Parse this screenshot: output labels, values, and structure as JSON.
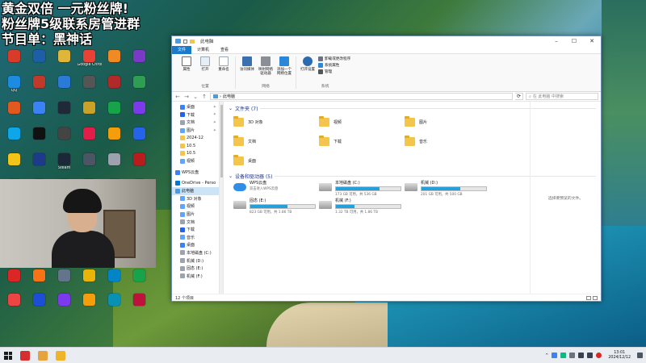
{
  "overlay": {
    "line1": "黄金双倍 一元粉丝牌!",
    "line2": "粉丝牌5级联系房管进群",
    "line3": "节目单：黑神话"
  },
  "desktop_icons": [
    {
      "label": "",
      "color": "#d83b2a"
    },
    {
      "label": "",
      "color": "#1c5fa8"
    },
    {
      "label": "",
      "color": "#e0b63a"
    },
    {
      "label": "Google Chrome",
      "color": "#e94235"
    },
    {
      "label": "",
      "color": "#f08a24"
    },
    {
      "label": "",
      "color": "#7b3ac6"
    },
    {
      "label": "QQ",
      "color": "#1d8ce0"
    },
    {
      "label": "",
      "color": "#c0392b"
    },
    {
      "label": "",
      "color": "#2b7bd6"
    },
    {
      "label": "",
      "color": "#555"
    },
    {
      "label": "",
      "color": "#b12a2a"
    },
    {
      "label": "",
      "color": "#2e9e53"
    },
    {
      "label": "",
      "color": "#e05a20"
    },
    {
      "label": "",
      "color": "#3b82f6"
    },
    {
      "label": "",
      "color": "#1f2937"
    },
    {
      "label": "",
      "color": "#c9a227"
    },
    {
      "label": "",
      "color": "#16a34a"
    },
    {
      "label": "",
      "color": "#7c3aed"
    },
    {
      "label": "",
      "color": "#0ea5e9"
    },
    {
      "label": "",
      "color": "#111"
    },
    {
      "label": "",
      "color": "#444"
    },
    {
      "label": "",
      "color": "#e11d48"
    },
    {
      "label": "",
      "color": "#f59e0b"
    },
    {
      "label": "",
      "color": "#2563eb"
    },
    {
      "label": "",
      "color": "#f0c419"
    },
    {
      "label": "",
      "color": "#1e3a8a"
    },
    {
      "label": "Steam",
      "color": "#1b2838"
    },
    {
      "label": "",
      "color": "#4b5563"
    },
    {
      "label": "",
      "color": "#9ca3af"
    },
    {
      "label": "",
      "color": "#b91c1c"
    },
    {
      "label": "",
      "color": "#e5484d"
    },
    {
      "label": "",
      "color": "#0f766e"
    },
    {
      "label": "",
      "color": "#dc2626"
    },
    {
      "label": "",
      "color": "#555"
    },
    {
      "label": "",
      "color": "#ea580c"
    },
    {
      "label": "",
      "color": "#334155"
    }
  ],
  "desktop_icons_bottom": [
    {
      "label": "",
      "color": "#dc2626"
    },
    {
      "label": "",
      "color": "#f97316"
    },
    {
      "label": "",
      "color": "#64748b"
    },
    {
      "label": "",
      "color": "#eab308"
    },
    {
      "label": "",
      "color": "#0284c7"
    },
    {
      "label": "",
      "color": "#16a34a"
    },
    {
      "label": "",
      "color": "#ef4444"
    },
    {
      "label": "",
      "color": "#1d4ed8"
    },
    {
      "label": "",
      "color": "#7c3aed"
    },
    {
      "label": "",
      "color": "#f59e0b"
    },
    {
      "label": "",
      "color": "#0891b2"
    },
    {
      "label": "",
      "color": "#be123c"
    }
  ],
  "window": {
    "title": "此电脑",
    "tabs": [
      "文件",
      "计算机",
      "查看"
    ],
    "ribbon": {
      "location_group": "位置",
      "network_group": "网络",
      "system_group": "系统",
      "properties": "属性",
      "open": "打开",
      "rename": "重命名",
      "access_media": "访问媒体",
      "map_drive": "映射网络驱动器",
      "add_location": "添加一个网络位置",
      "open_settings": "打开设置",
      "uninstall": "卸载或更改程序",
      "sys_props": "系统属性",
      "manage": "管理"
    },
    "address": "此电脑",
    "search_placeholder": "在 此电脑 中搜索"
  },
  "nav": [
    {
      "label": "桌面",
      "sub": true,
      "pin": true,
      "color": "#3b82f6"
    },
    {
      "label": "下载",
      "sub": true,
      "pin": true,
      "color": "#2563eb"
    },
    {
      "label": "文档",
      "sub": true,
      "pin": true,
      "color": "#9ca3af"
    },
    {
      "label": "图片",
      "sub": true,
      "pin": true,
      "color": "#60a5fa"
    },
    {
      "label": "2024-12",
      "sub": true,
      "pin": false,
      "color": "#f3c54d"
    },
    {
      "label": "10.5",
      "sub": true,
      "pin": false,
      "color": "#f3c54d"
    },
    {
      "label": "10.5",
      "sub": true,
      "pin": false,
      "color": "#f3c54d"
    },
    {
      "label": "视频",
      "sub": true,
      "pin": false,
      "color": "#60a5fa"
    },
    {
      "label": "",
      "gap": true
    },
    {
      "label": "WPS云盘",
      "sub": false,
      "pin": false,
      "color": "#3b82f6"
    },
    {
      "label": "",
      "gap": true
    },
    {
      "label": "OneDrive - Perso",
      "sub": false,
      "pin": false,
      "color": "#0078d4"
    },
    {
      "label": "此电脑",
      "sub": false,
      "pin": false,
      "color": "#4b9be0",
      "sel": true
    },
    {
      "label": "3D 对象",
      "sub": true,
      "pin": false,
      "color": "#60a5fa"
    },
    {
      "label": "视频",
      "sub": true,
      "pin": false,
      "color": "#60a5fa"
    },
    {
      "label": "图片",
      "sub": true,
      "pin": false,
      "color": "#60a5fa"
    },
    {
      "label": "文档",
      "sub": true,
      "pin": false,
      "color": "#9ca3af"
    },
    {
      "label": "下载",
      "sub": true,
      "pin": false,
      "color": "#2563eb"
    },
    {
      "label": "音乐",
      "sub": true,
      "pin": false,
      "color": "#60a5fa"
    },
    {
      "label": "桌面",
      "sub": true,
      "pin": false,
      "color": "#3b82f6"
    },
    {
      "label": "本地磁盘 (C:)",
      "sub": true,
      "pin": false,
      "color": "#9ca3af"
    },
    {
      "label": "机械 (D:)",
      "sub": true,
      "pin": false,
      "color": "#9ca3af"
    },
    {
      "label": "固态 (E:)",
      "sub": true,
      "pin": false,
      "color": "#9ca3af"
    },
    {
      "label": "机械 (F:)",
      "sub": true,
      "pin": false,
      "color": "#9ca3af"
    }
  ],
  "folders_header": "文件夹 (7)",
  "folders": [
    {
      "label": "3D 对象"
    },
    {
      "label": "视频"
    },
    {
      "label": "图片"
    },
    {
      "label": "文档"
    },
    {
      "label": "下载"
    },
    {
      "label": "音乐"
    },
    {
      "label": "桌面"
    }
  ],
  "drives_header": "设备和驱动器 (5)",
  "drives": [
    {
      "name": "WPS云盘",
      "cap": "双击进入WPS云盘",
      "fill": 0,
      "cloud": true
    },
    {
      "name": "本地磁盘 (C:)",
      "cap": "173 GB 可用，共 536 GB",
      "fill": 0.68
    },
    {
      "name": "机械 (D:)",
      "cap": "201 GB 可用，共 500 GB",
      "fill": 0.6
    },
    {
      "name": "固态 (E:)",
      "cap": "823 GB 可用，共 1.86 TB",
      "fill": 0.57
    },
    {
      "name": "机械 (F:)",
      "cap": "1.32 TB 可用，共 1.86 TB",
      "fill": 0.29
    }
  ],
  "preview_text": "选择要预览的文件。",
  "status": "12 个项目",
  "taskbar": {
    "apps": [
      {
        "color": "#d62f2f"
      },
      {
        "color": "#e6a23c"
      },
      {
        "color": "#f0b429"
      }
    ],
    "time": "13:01",
    "date": "2024/12/12"
  }
}
